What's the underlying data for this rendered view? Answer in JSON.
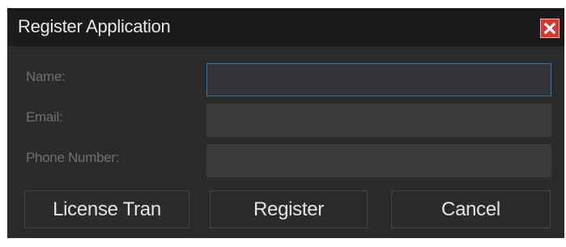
{
  "window": {
    "title": "Register Application",
    "close_icon": "close-icon"
  },
  "form": {
    "name_label": "Name:",
    "email_label": "Email:",
    "phone_label": "Phone Number:",
    "name_value": "",
    "email_value": "",
    "phone_value": ""
  },
  "buttons": {
    "license_label": "License Tran",
    "register_label": "Register",
    "cancel_label": "Cancel"
  },
  "colors": {
    "background": "#2b2b2b",
    "titlebar": "#1b1b1b",
    "input_bg": "#3b3b3d",
    "focus_border": "#1f78b4",
    "close_red": "#d3382f"
  }
}
